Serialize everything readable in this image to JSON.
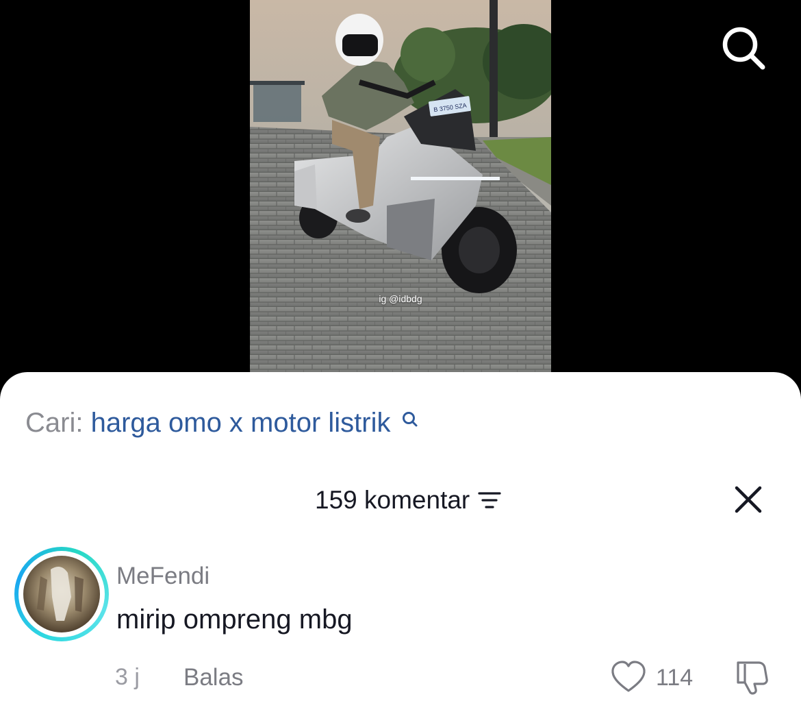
{
  "video": {
    "watermark": "ig @idbdg",
    "plate_text": "B 3750 SZA"
  },
  "top_bar": {
    "search_icon": "search-icon"
  },
  "comments": {
    "search_prefix": "Cari:",
    "search_query": "harga omo x motor listrik",
    "count_label": "159 komentar",
    "icons": {
      "sort": "filter-lines-icon",
      "close": "close-icon"
    },
    "items": [
      {
        "username": "MeFendi",
        "text": "mirip ompreng mbg",
        "time": "3 j",
        "reply_label": "Balas",
        "likes": "114",
        "icons": {
          "like": "heart-icon",
          "dislike": "thumbs-down-icon"
        }
      }
    ]
  },
  "colors": {
    "link_blue": "#2e5a9c",
    "avatar_ring": "#2fd9e0",
    "text_primary": "#161823",
    "text_secondary": "#7b7c83"
  }
}
